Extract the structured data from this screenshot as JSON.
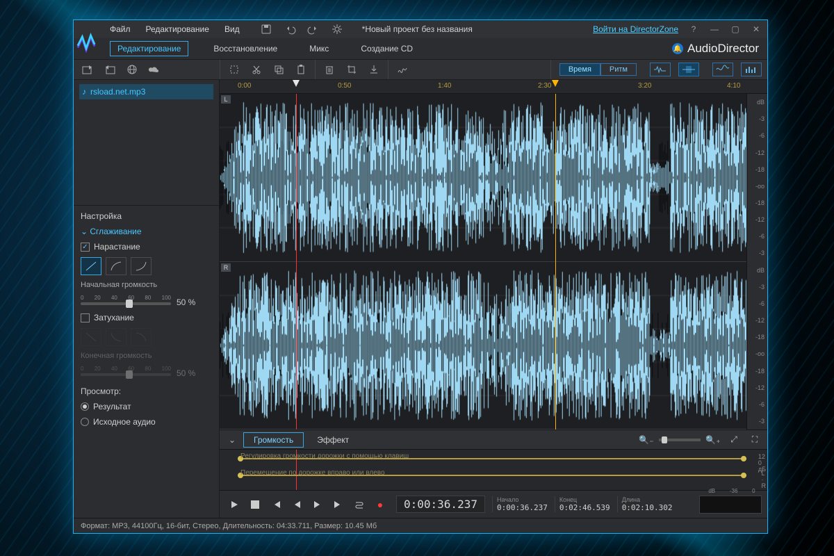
{
  "menu": {
    "file": "Файл",
    "edit": "Редактирование",
    "view": "Вид"
  },
  "project_title": "*Новый проект без названия",
  "signin": "Войти на DirectorZone",
  "help": "?",
  "tabs": {
    "edit": "Редактирование",
    "restore": "Восстановление",
    "mix": "Микс",
    "cd": "Создание CD"
  },
  "brand": "AudioDirector",
  "mode": {
    "time": "Время",
    "rhythm": "Ритм"
  },
  "file": {
    "name": "rsload.net.mp3"
  },
  "settings": {
    "title": "Настройка",
    "section": "Сглаживание",
    "fadein": "Нарастание",
    "start_vol": "Начальная громкость",
    "start_pct": "50 %",
    "fadeout": "Затухание",
    "end_vol": "Конечная громкость",
    "end_pct": "50 %",
    "ticks": [
      "0",
      "20",
      "40",
      "60",
      "80",
      "100"
    ],
    "preview": "Просмотр:",
    "result": "Результат",
    "original": "Исходное аудио"
  },
  "ruler": {
    "t0": "0:00",
    "t1": "0:50",
    "t2": "1:40",
    "t3": "2:30",
    "t4": "3:20",
    "t5": "4:10"
  },
  "db": {
    "unit": "dB",
    "m3": "-3",
    "m6": "-6",
    "m12": "-12",
    "m18": "-18",
    "inf": "-oo"
  },
  "midtabs": {
    "volume": "Громкость",
    "effect": "Эффект"
  },
  "lanes": {
    "vol": "Регулировка громкости дорожки с помощью клавиш",
    "pan": "Перемещение по дорожке вправо или влево",
    "db12": "12",
    "db0": "0",
    "dbu": "дБ",
    "L": "L",
    "R": "R"
  },
  "transport": {
    "time": "0:00:36.237",
    "start_l": "Начало",
    "start_v": "0:00:36.237",
    "end_l": "Конец",
    "end_v": "0:02:46.539",
    "len_l": "Длина",
    "len_v": "0:02:10.302",
    "meter": {
      "a": "dB",
      "b": "-36",
      "c": "0"
    }
  },
  "status": "Формат: MP3, 44100Гц, 16-бит, Стерео, Длительность: 04:33.711, Размер: 10.45 Мб"
}
